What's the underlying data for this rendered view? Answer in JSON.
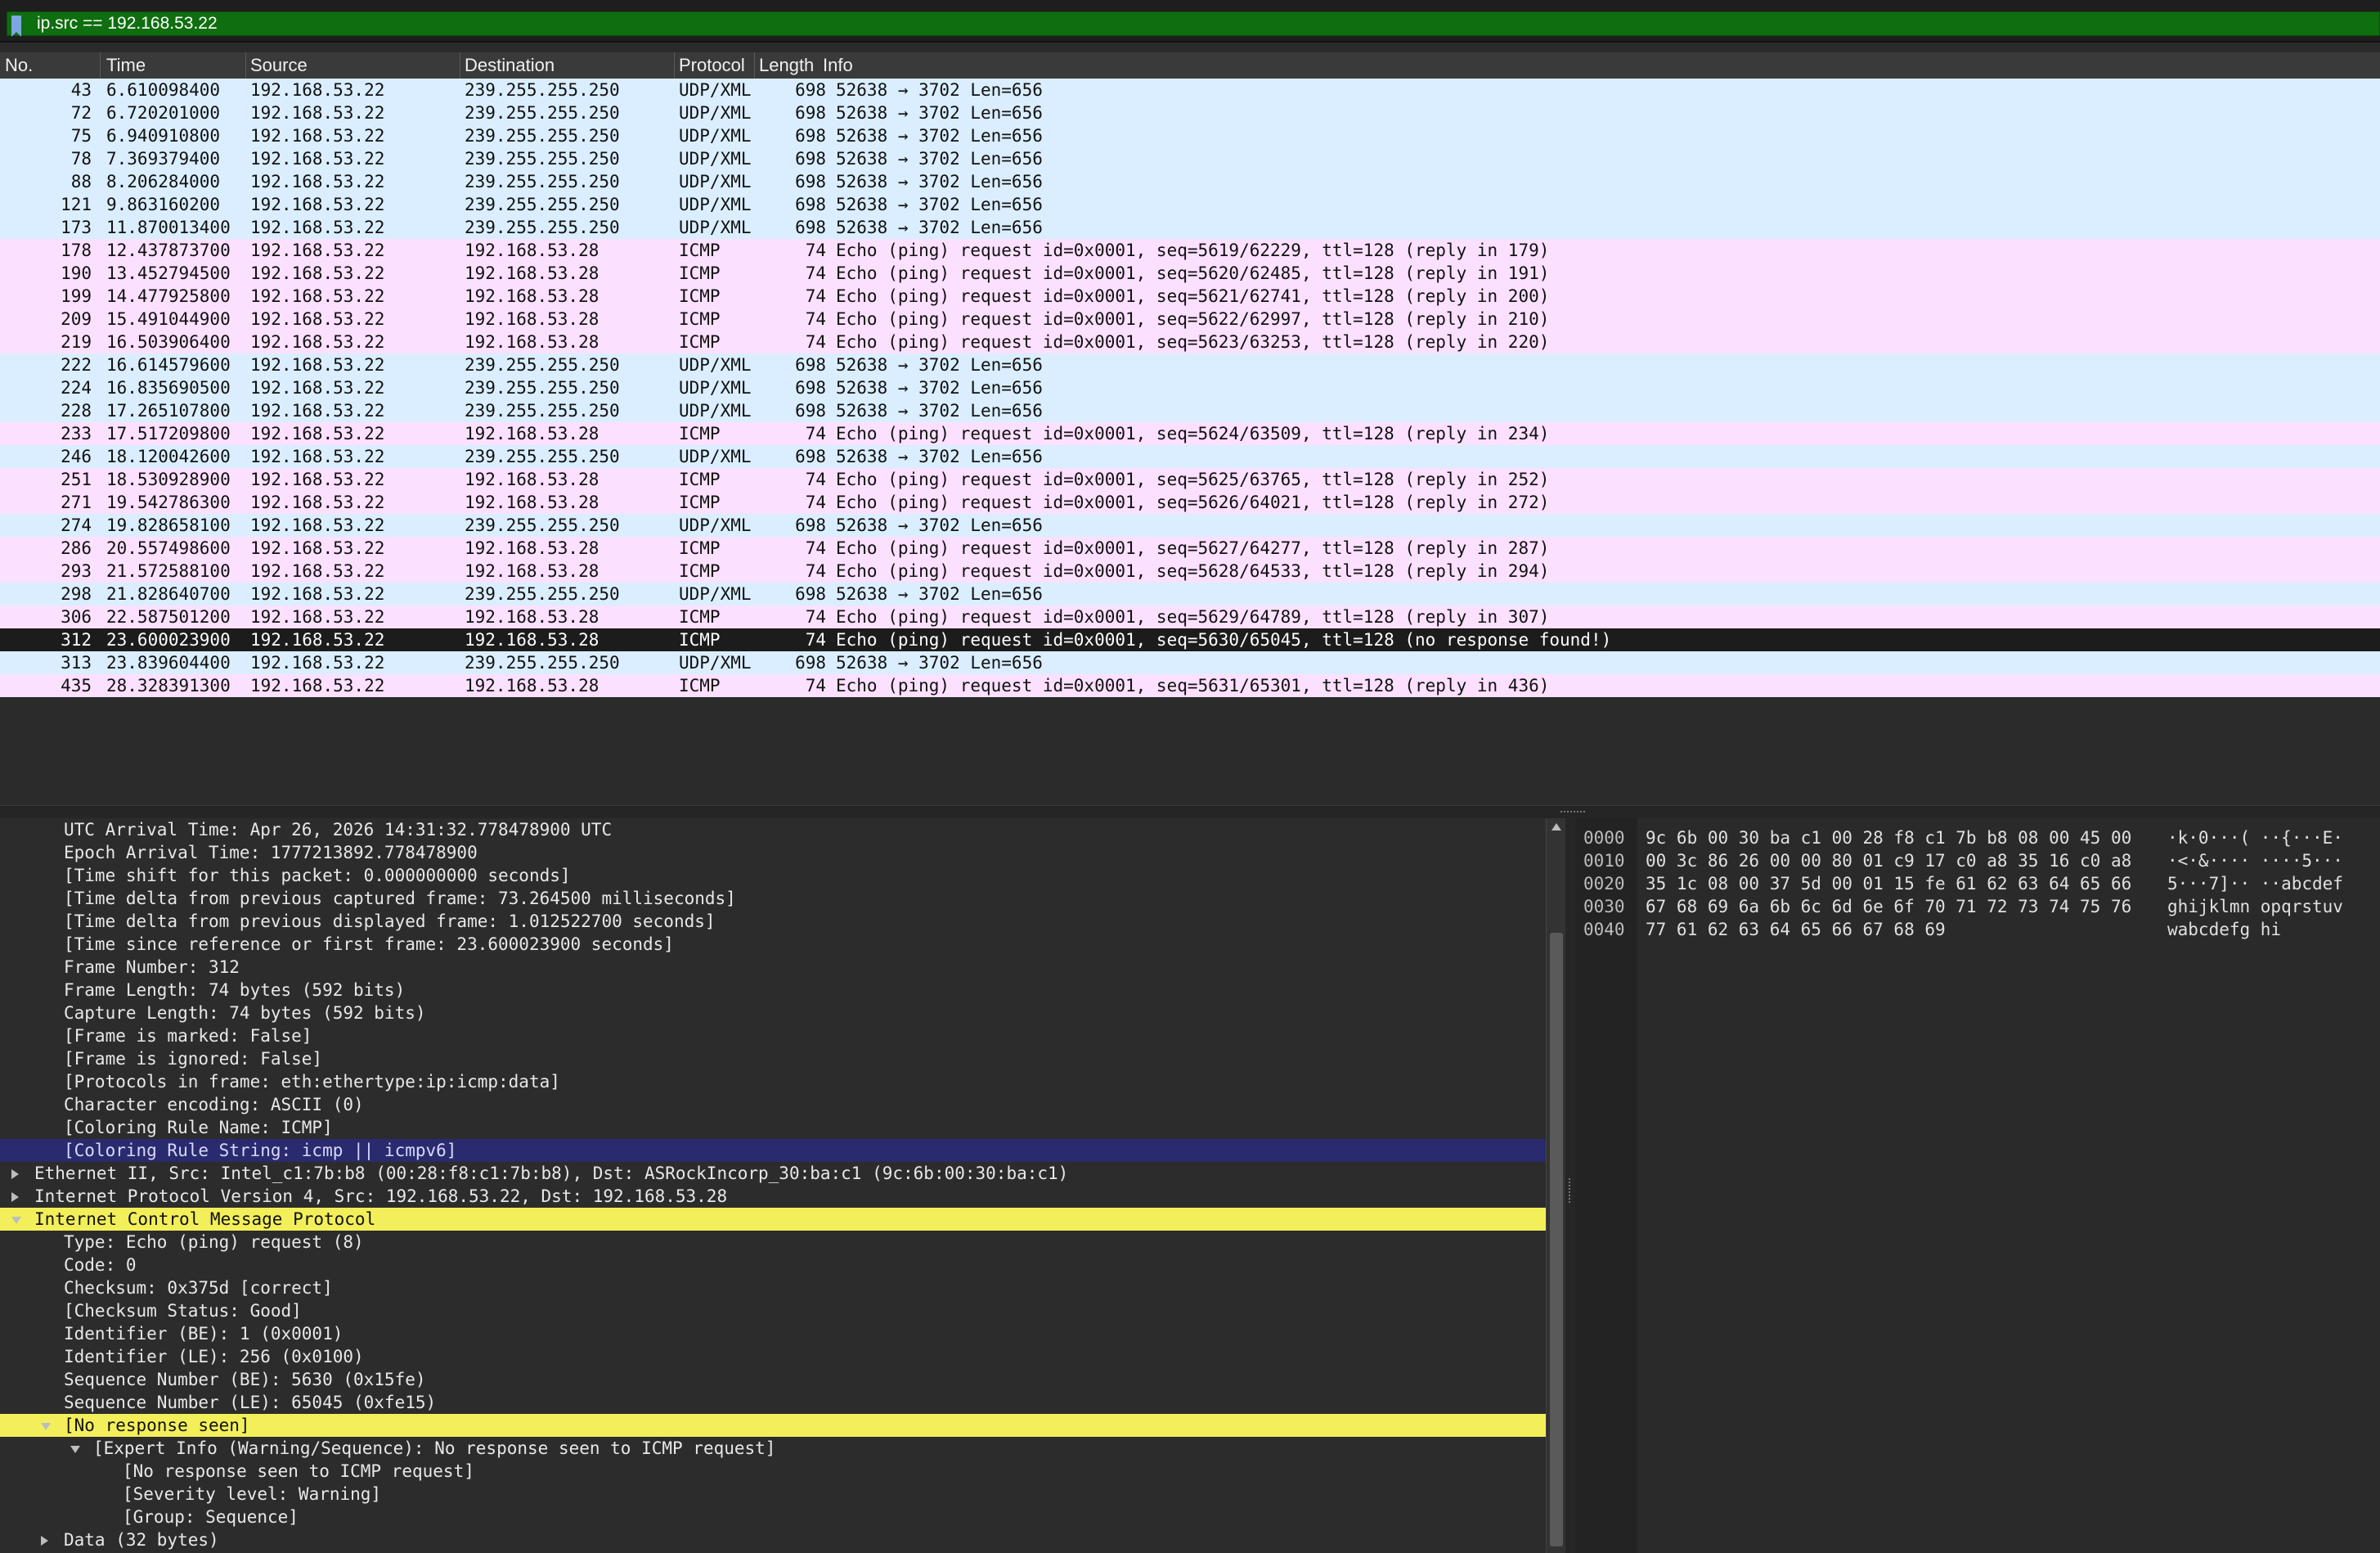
{
  "filter": {
    "text": "ip.src == 192.168.53.22"
  },
  "columns": [
    "No.",
    "Time",
    "Source",
    "Destination",
    "Protocol",
    "Length",
    "Info"
  ],
  "packets": [
    {
      "no": "43",
      "time": "6.610098400",
      "src": "192.168.53.22",
      "dst": "239.255.255.250",
      "proto": "UDP/XML",
      "len": "698",
      "info": "52638 → 3702 Len=656",
      "kind": "udp"
    },
    {
      "no": "72",
      "time": "6.720201000",
      "src": "192.168.53.22",
      "dst": "239.255.255.250",
      "proto": "UDP/XML",
      "len": "698",
      "info": "52638 → 3702 Len=656",
      "kind": "udp"
    },
    {
      "no": "75",
      "time": "6.940910800",
      "src": "192.168.53.22",
      "dst": "239.255.255.250",
      "proto": "UDP/XML",
      "len": "698",
      "info": "52638 → 3702 Len=656",
      "kind": "udp"
    },
    {
      "no": "78",
      "time": "7.369379400",
      "src": "192.168.53.22",
      "dst": "239.255.255.250",
      "proto": "UDP/XML",
      "len": "698",
      "info": "52638 → 3702 Len=656",
      "kind": "udp"
    },
    {
      "no": "88",
      "time": "8.206284000",
      "src": "192.168.53.22",
      "dst": "239.255.255.250",
      "proto": "UDP/XML",
      "len": "698",
      "info": "52638 → 3702 Len=656",
      "kind": "udp"
    },
    {
      "no": "121",
      "time": "9.863160200",
      "src": "192.168.53.22",
      "dst": "239.255.255.250",
      "proto": "UDP/XML",
      "len": "698",
      "info": "52638 → 3702 Len=656",
      "kind": "udp"
    },
    {
      "no": "173",
      "time": "11.870013400",
      "src": "192.168.53.22",
      "dst": "239.255.255.250",
      "proto": "UDP/XML",
      "len": "698",
      "info": "52638 → 3702 Len=656",
      "kind": "udp"
    },
    {
      "no": "178",
      "time": "12.437873700",
      "src": "192.168.53.22",
      "dst": "192.168.53.28",
      "proto": "ICMP",
      "len": "74",
      "info": "Echo (ping) request  id=0x0001, seq=5619/62229, ttl=128 (reply in 179)",
      "kind": "icmp"
    },
    {
      "no": "190",
      "time": "13.452794500",
      "src": "192.168.53.22",
      "dst": "192.168.53.28",
      "proto": "ICMP",
      "len": "74",
      "info": "Echo (ping) request  id=0x0001, seq=5620/62485, ttl=128 (reply in 191)",
      "kind": "icmp"
    },
    {
      "no": "199",
      "time": "14.477925800",
      "src": "192.168.53.22",
      "dst": "192.168.53.28",
      "proto": "ICMP",
      "len": "74",
      "info": "Echo (ping) request  id=0x0001, seq=5621/62741, ttl=128 (reply in 200)",
      "kind": "icmp"
    },
    {
      "no": "209",
      "time": "15.491044900",
      "src": "192.168.53.22",
      "dst": "192.168.53.28",
      "proto": "ICMP",
      "len": "74",
      "info": "Echo (ping) request  id=0x0001, seq=5622/62997, ttl=128 (reply in 210)",
      "kind": "icmp"
    },
    {
      "no": "219",
      "time": "16.503906400",
      "src": "192.168.53.22",
      "dst": "192.168.53.28",
      "proto": "ICMP",
      "len": "74",
      "info": "Echo (ping) request  id=0x0001, seq=5623/63253, ttl=128 (reply in 220)",
      "kind": "icmp"
    },
    {
      "no": "222",
      "time": "16.614579600",
      "src": "192.168.53.22",
      "dst": "239.255.255.250",
      "proto": "UDP/XML",
      "len": "698",
      "info": "52638 → 3702 Len=656",
      "kind": "udp"
    },
    {
      "no": "224",
      "time": "16.835690500",
      "src": "192.168.53.22",
      "dst": "239.255.255.250",
      "proto": "UDP/XML",
      "len": "698",
      "info": "52638 → 3702 Len=656",
      "kind": "udp"
    },
    {
      "no": "228",
      "time": "17.265107800",
      "src": "192.168.53.22",
      "dst": "239.255.255.250",
      "proto": "UDP/XML",
      "len": "698",
      "info": "52638 → 3702 Len=656",
      "kind": "udp"
    },
    {
      "no": "233",
      "time": "17.517209800",
      "src": "192.168.53.22",
      "dst": "192.168.53.28",
      "proto": "ICMP",
      "len": "74",
      "info": "Echo (ping) request  id=0x0001, seq=5624/63509, ttl=128 (reply in 234)",
      "kind": "icmp"
    },
    {
      "no": "246",
      "time": "18.120042600",
      "src": "192.168.53.22",
      "dst": "239.255.255.250",
      "proto": "UDP/XML",
      "len": "698",
      "info": "52638 → 3702 Len=656",
      "kind": "udp"
    },
    {
      "no": "251",
      "time": "18.530928900",
      "src": "192.168.53.22",
      "dst": "192.168.53.28",
      "proto": "ICMP",
      "len": "74",
      "info": "Echo (ping) request  id=0x0001, seq=5625/63765, ttl=128 (reply in 252)",
      "kind": "icmp"
    },
    {
      "no": "271",
      "time": "19.542786300",
      "src": "192.168.53.22",
      "dst": "192.168.53.28",
      "proto": "ICMP",
      "len": "74",
      "info": "Echo (ping) request  id=0x0001, seq=5626/64021, ttl=128 (reply in 272)",
      "kind": "icmp"
    },
    {
      "no": "274",
      "time": "19.828658100",
      "src": "192.168.53.22",
      "dst": "239.255.255.250",
      "proto": "UDP/XML",
      "len": "698",
      "info": "52638 → 3702 Len=656",
      "kind": "udp"
    },
    {
      "no": "286",
      "time": "20.557498600",
      "src": "192.168.53.22",
      "dst": "192.168.53.28",
      "proto": "ICMP",
      "len": "74",
      "info": "Echo (ping) request  id=0x0001, seq=5627/64277, ttl=128 (reply in 287)",
      "kind": "icmp"
    },
    {
      "no": "293",
      "time": "21.572588100",
      "src": "192.168.53.22",
      "dst": "192.168.53.28",
      "proto": "ICMP",
      "len": "74",
      "info": "Echo (ping) request  id=0x0001, seq=5628/64533, ttl=128 (reply in 294)",
      "kind": "icmp"
    },
    {
      "no": "298",
      "time": "21.828640700",
      "src": "192.168.53.22",
      "dst": "239.255.255.250",
      "proto": "UDP/XML",
      "len": "698",
      "info": "52638 → 3702 Len=656",
      "kind": "udp"
    },
    {
      "no": "306",
      "time": "22.587501200",
      "src": "192.168.53.22",
      "dst": "192.168.53.28",
      "proto": "ICMP",
      "len": "74",
      "info": "Echo (ping) request  id=0x0001, seq=5629/64789, ttl=128 (reply in 307)",
      "kind": "icmp"
    },
    {
      "no": "312",
      "time": "23.600023900",
      "src": "192.168.53.22",
      "dst": "192.168.53.28",
      "proto": "ICMP",
      "len": "74",
      "info": "Echo (ping) request  id=0x0001, seq=5630/65045, ttl=128 (no response found!)",
      "kind": "sel"
    },
    {
      "no": "313",
      "time": "23.839604400",
      "src": "192.168.53.22",
      "dst": "239.255.255.250",
      "proto": "UDP/XML",
      "len": "698",
      "info": "52638 → 3702 Len=656",
      "kind": "udp"
    },
    {
      "no": "435",
      "time": "28.328391300",
      "src": "192.168.53.22",
      "dst": "192.168.53.28",
      "proto": "ICMP",
      "len": "74",
      "info": "Echo (ping) request  id=0x0001, seq=5631/65301, ttl=128 (reply in 436)",
      "kind": "icmp"
    }
  ],
  "details": [
    {
      "text": "UTC Arrival Time: Apr 26, 2026 14:31:32.778478900 UTC",
      "level": 2,
      "tree": "none",
      "style": ""
    },
    {
      "text": "Epoch Arrival Time: 1777213892.778478900",
      "level": 2,
      "tree": "none",
      "style": ""
    },
    {
      "text": "[Time shift for this packet: 0.000000000 seconds]",
      "level": 2,
      "tree": "none",
      "style": ""
    },
    {
      "text": "[Time delta from previous captured frame: 73.264500 milliseconds]",
      "level": 2,
      "tree": "none",
      "style": ""
    },
    {
      "text": "[Time delta from previous displayed frame: 1.012522700 seconds]",
      "level": 2,
      "tree": "none",
      "style": ""
    },
    {
      "text": "[Time since reference or first frame: 23.600023900 seconds]",
      "level": 2,
      "tree": "none",
      "style": ""
    },
    {
      "text": "Frame Number: 312",
      "level": 2,
      "tree": "none",
      "style": ""
    },
    {
      "text": "Frame Length: 74 bytes (592 bits)",
      "level": 2,
      "tree": "none",
      "style": ""
    },
    {
      "text": "Capture Length: 74 bytes (592 bits)",
      "level": 2,
      "tree": "none",
      "style": ""
    },
    {
      "text": "[Frame is marked: False]",
      "level": 2,
      "tree": "none",
      "style": ""
    },
    {
      "text": "[Frame is ignored: False]",
      "level": 2,
      "tree": "none",
      "style": ""
    },
    {
      "text": "[Protocols in frame: eth:ethertype:ip:icmp:data]",
      "level": 2,
      "tree": "none",
      "style": ""
    },
    {
      "text": "Character encoding: ASCII (0)",
      "level": 2,
      "tree": "none",
      "style": ""
    },
    {
      "text": "[Coloring Rule Name: ICMP]",
      "level": 2,
      "tree": "none",
      "style": ""
    },
    {
      "text": "[Coloring Rule String: icmp || icmpv6]",
      "level": 2,
      "tree": "none",
      "style": "sel-blue"
    },
    {
      "text": "Ethernet II, Src: Intel_c1:7b:b8 (00:28:f8:c1:7b:b8), Dst: ASRockIncorp_30:ba:c1 (9c:6b:00:30:ba:c1)",
      "level": 1,
      "tree": "right",
      "style": ""
    },
    {
      "text": "Internet Protocol Version 4, Src: 192.168.53.22, Dst: 192.168.53.28",
      "level": 1,
      "tree": "right",
      "style": ""
    },
    {
      "text": "Internet Control Message Protocol",
      "level": 1,
      "tree": "down",
      "style": "hl-yellow"
    },
    {
      "text": "Type: Echo (ping) request (8)",
      "level": 2,
      "tree": "none",
      "style": ""
    },
    {
      "text": "Code: 0",
      "level": 2,
      "tree": "none",
      "style": ""
    },
    {
      "text": "Checksum: 0x375d [correct]",
      "level": 2,
      "tree": "none",
      "style": ""
    },
    {
      "text": "[Checksum Status: Good]",
      "level": 2,
      "tree": "none",
      "style": ""
    },
    {
      "text": "Identifier (BE): 1 (0x0001)",
      "level": 2,
      "tree": "none",
      "style": ""
    },
    {
      "text": "Identifier (LE): 256 (0x0100)",
      "level": 2,
      "tree": "none",
      "style": ""
    },
    {
      "text": "Sequence Number (BE): 5630 (0x15fe)",
      "level": 2,
      "tree": "none",
      "style": ""
    },
    {
      "text": "Sequence Number (LE): 65045 (0xfe15)",
      "level": 2,
      "tree": "none",
      "style": ""
    },
    {
      "text": "[No response seen]",
      "level": 2,
      "tree": "down",
      "style": "hl-yellow"
    },
    {
      "text": "[Expert Info (Warning/Sequence): No response seen to ICMP request]",
      "level": 3,
      "tree": "down",
      "style": ""
    },
    {
      "text": "[No response seen to ICMP request]",
      "level": 4,
      "tree": "none",
      "style": ""
    },
    {
      "text": "[Severity level: Warning]",
      "level": 4,
      "tree": "none",
      "style": ""
    },
    {
      "text": "[Group: Sequence]",
      "level": 4,
      "tree": "none",
      "style": ""
    },
    {
      "text": "Data (32 bytes)",
      "level": 2,
      "tree": "right",
      "style": ""
    }
  ],
  "bytes": [
    {
      "offset": "0000",
      "hex": "9c 6b 00 30 ba c1 00 28  f8 c1 7b b8 08 00 45 00",
      "ascii": "·k·0···( ··{···E·"
    },
    {
      "offset": "0010",
      "hex": "00 3c 86 26 00 00 80 01  c9 17 c0 a8 35 16 c0 a8",
      "ascii": "·<·&···· ····5···"
    },
    {
      "offset": "0020",
      "hex": "35 1c 08 00 37 5d 00 01  15 fe 61 62 63 64 65 66",
      "ascii": "5···7]·· ··abcdef"
    },
    {
      "offset": "0030",
      "hex": "67 68 69 6a 6b 6c 6d 6e  6f 70 71 72 73 74 75 76",
      "ascii": "ghijklmn opqrstuv"
    },
    {
      "offset": "0040",
      "hex": "77 61 62 63 64 65 66 67  68 69",
      "ascii": "wabcdefg hi"
    }
  ],
  "colors": {
    "filter_bg": "#0f6e0f",
    "udp_row": "#daeeff",
    "icmp_row": "#fce0ff",
    "selected_row": "#1c1c1c",
    "highlight_yellow": "#f3ef5a",
    "highlight_blue": "#2a2a6e"
  }
}
